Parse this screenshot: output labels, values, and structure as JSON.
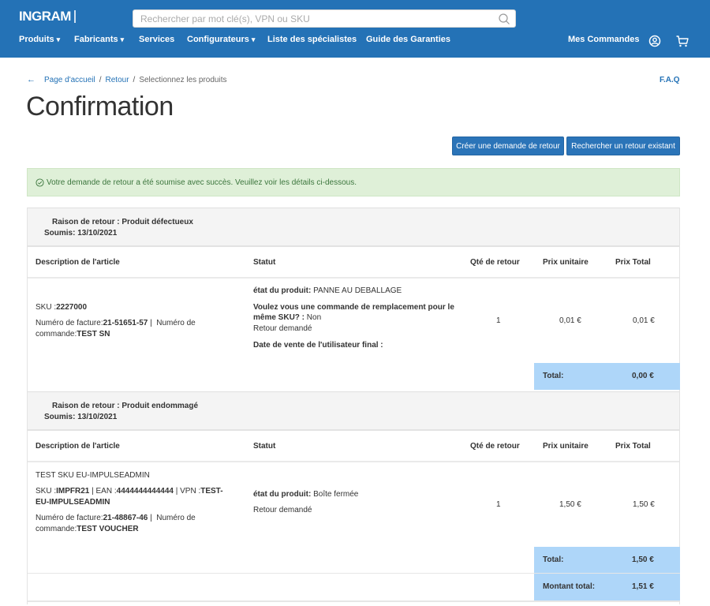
{
  "header": {
    "logo": "INGRAM",
    "search_placeholder": "Rechercher par mot clé(s), VPN ou SKU",
    "nav": [
      {
        "label": "Produits",
        "has_dropdown": true
      },
      {
        "label": "Fabricants",
        "has_dropdown": true
      },
      {
        "label": "Services",
        "has_dropdown": false
      },
      {
        "label": "Configurateurs",
        "has_dropdown": true
      },
      {
        "label": "Liste des spécialistes",
        "has_dropdown": false
      },
      {
        "label": "Guide des Garanties",
        "has_dropdown": false
      }
    ],
    "caret": "▾",
    "my_orders": "Mes Commandes",
    "icons": {
      "account": "user-circle-icon",
      "cart": "cart-icon",
      "search": "search-icon"
    }
  },
  "breadcrumb": {
    "back_icon": "←",
    "items": [
      "Page d'accueil",
      "Retour",
      "Selectionnez les produits"
    ],
    "separator": "/"
  },
  "faq": "F.A.Q",
  "page_title": "Confirmation",
  "buttons": {
    "create": "Créer une demande de retour",
    "search": "Rechercher un retour existant"
  },
  "alert": {
    "icon": "check-circle-icon",
    "message": "Votre demande de retour a été soumise avec succès. Veuillez voir les détails ci-dessous.",
    "color": "#3c763d"
  },
  "columns": [
    "Description de l'article",
    "Statut",
    "Qté de retour",
    "Prix unitaire",
    "Prix Total"
  ],
  "returns": [
    {
      "reason": "Raison de retour : Produit défectueux",
      "submitted": "Soumis: 13/10/2021",
      "item": {
        "sku_label": "SKU :",
        "sku": "2227000",
        "invoice_label": "Numéro de facture:",
        "invoice": "21-51651-57",
        "sep": " | ",
        "order_label": "Numéro de commande:",
        "order": "TEST SN",
        "status_label": "état du produit:",
        "status": " PANNE AU DEBALLAGE",
        "replacement_q": "Voulez vous une commande de remplacement pour le même SKU? :",
        "replacement_a": " Non",
        "return_status": "Retour demandé",
        "end_user_date": "Date de vente de l'utilisateur final :",
        "qty": "1",
        "unit_price": "0,01 €",
        "total_price": "0,01 €"
      },
      "total_label": "Total:",
      "total": "0,00 €"
    },
    {
      "reason": "Raison de retour : Produit endommagé",
      "submitted": "Soumis: 13/10/2021",
      "item": {
        "name": "TEST SKU EU-IMPULSEADMIN",
        "sku_label": "SKU :",
        "sku": "IMPFR21",
        "ean_label": " | EAN :",
        "ean": "4444444444444",
        "vpn_label": " | VPN :",
        "vpn": "TEST-EU-IMPULSEADMIN",
        "invoice_label": "Numéro de facture:",
        "invoice": "21-48867-46",
        "sep": " | ",
        "order_label": "Numéro de commande:",
        "order": "TEST VOUCHER",
        "status_label": "état du produit:",
        "status": " Boîte fermée",
        "return_status": "Retour demandé",
        "qty": "1",
        "unit_price": "1,50 €",
        "total_price": "1,50 €"
      },
      "total_label": "Total:",
      "total": "1,50 €"
    }
  ],
  "grand_total": {
    "label": "Montant total:",
    "value": "1,51 €"
  },
  "colors": {
    "brand": "#2472b6",
    "button": "#2b74b8",
    "total_bg": "#aed6f9",
    "alert_bg": "#dff0d8"
  }
}
